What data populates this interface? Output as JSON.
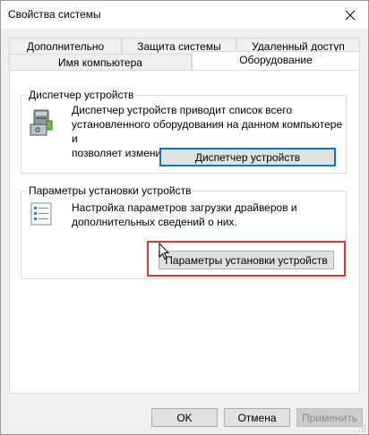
{
  "window": {
    "title": "Свойства системы"
  },
  "tabs_back": [
    "Дополнительно",
    "Защита системы",
    "Удаленный доступ"
  ],
  "tabs_front": [
    "Имя компьютера",
    "Оборудование"
  ],
  "device_manager": {
    "title": "Диспетчер устройств",
    "description_lines": [
      "Диспетчер устройств приводит список всего",
      "установленного оборудования на данном компьютере и",
      "позволяет изменить свойства любого устройства."
    ],
    "button": "Диспетчер устройств",
    "icon": "computer-hardware-icon"
  },
  "install_settings": {
    "title": "Параметры установки устройств",
    "description_lines": [
      "Настройка параметров загрузки драйверов и",
      "дополнительных сведений о них."
    ],
    "button": "Параметры установки устройств",
    "icon": "checklist-icon",
    "highlight_color": "#d33b3b"
  },
  "footer": {
    "ok": "OK",
    "cancel": "Отмена",
    "apply": "Применить"
  },
  "colors": {
    "accent": "#0078d7"
  }
}
